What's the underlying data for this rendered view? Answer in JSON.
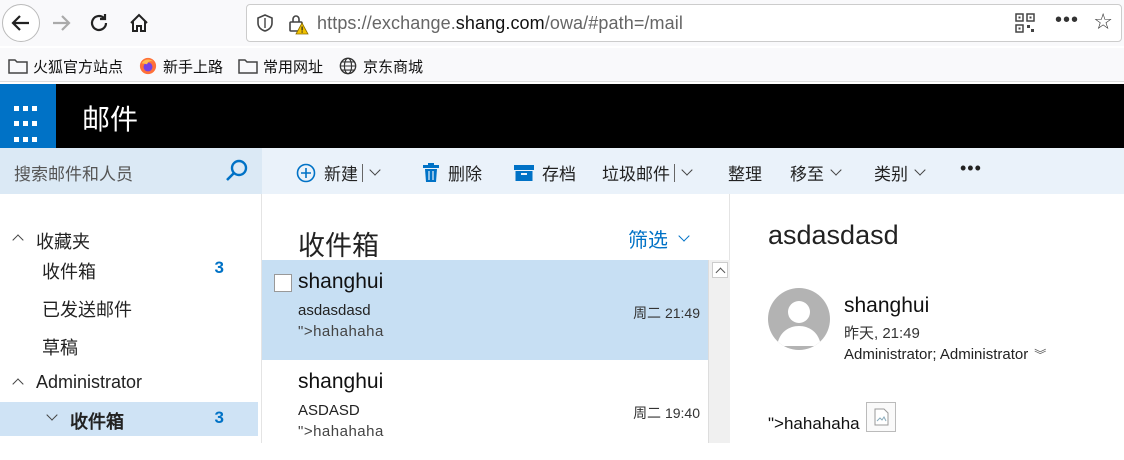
{
  "browser": {
    "url_prefix": "https://exchange.",
    "url_domain": "shang.com",
    "url_suffix": "/owa/#path=/mail",
    "more_label": "•••"
  },
  "bookmarks": [
    {
      "label": "火狐官方站点",
      "icon": "folder-icon"
    },
    {
      "label": "新手上路",
      "icon": "firefox-icon"
    },
    {
      "label": "常用网址",
      "icon": "folder-icon"
    },
    {
      "label": "京东商城",
      "icon": "globe-icon"
    }
  ],
  "header": {
    "app_title": "邮件",
    "brand_color": "#0072c6"
  },
  "search": {
    "placeholder": "搜索邮件和人员"
  },
  "commands": {
    "new": "新建",
    "delete": "删除",
    "archive": "存档",
    "junk": "垃圾邮件",
    "sweep": "整理",
    "move": "移至",
    "categorize": "类别",
    "more": "•••"
  },
  "folders": {
    "favorites": {
      "label": "收藏夹"
    },
    "fav_inbox": {
      "label": "收件箱",
      "count": "3"
    },
    "sent": {
      "label": "已发送邮件"
    },
    "drafts": {
      "label": "草稿"
    },
    "account": {
      "label": "Administrator"
    },
    "acct_inbox": {
      "label": "收件箱",
      "count": "3"
    }
  },
  "list": {
    "title": "收件箱",
    "filter": "筛选",
    "messages": [
      {
        "from": "shanghui",
        "subject": "asdasdasd",
        "time": "周二 21:49",
        "preview": "\">hahahaha"
      },
      {
        "from": "shanghui",
        "subject": "ASDASD",
        "time": "周二 19:40",
        "preview": "\">hahahaha"
      }
    ]
  },
  "reading": {
    "subject": "asdasdasd",
    "from": "shanghui",
    "date": "昨天, 21:49",
    "to": "Administrator; Administrator",
    "body": "\">hahahaha"
  }
}
